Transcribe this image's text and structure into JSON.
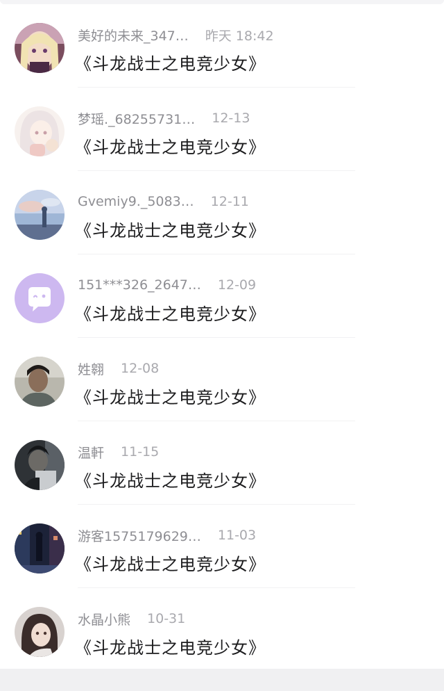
{
  "conversations": [
    {
      "name": "美好的未来_347…",
      "time": "昨天 18:42",
      "message": "《斗龙战士之电竞少女》",
      "avatar": "anime-girl-avatar"
    },
    {
      "name": "梦瑶._68255731…",
      "time": "12-13",
      "message": "《斗龙战士之电竞少女》",
      "avatar": "white-haired-girl-avatar"
    },
    {
      "name": "Gvemiy9._5083…",
      "time": "12-11",
      "message": "《斗龙战士之电竞少女》",
      "avatar": "sky-scene-avatar"
    },
    {
      "name": "151***326_2647…",
      "time": "12-09",
      "message": "《斗龙战士之电竞少女》",
      "avatar": "default-chat-avatar"
    },
    {
      "name": "姓翱",
      "time": "12-08",
      "message": "《斗龙战士之电竞少女》",
      "avatar": "man-photo-avatar"
    },
    {
      "name": "温軒",
      "time": "11-15",
      "message": "《斗龙战士之电竞少女》",
      "avatar": "dark-portrait-avatar"
    },
    {
      "name": "游客1575179629…",
      "time": "11-03",
      "message": "《斗龙战士之电竞少女》",
      "avatar": "night-street-avatar"
    },
    {
      "name": "水晶小熊",
      "time": "10-31",
      "message": "《斗龙战士之电竞少女》",
      "avatar": "girl-portrait-avatar"
    }
  ],
  "colors": {
    "name_text": "#8e8e93",
    "time_text": "#a9a9ae",
    "message_text": "#1c1c1e",
    "default_avatar_bg": "#cdb8f0"
  }
}
